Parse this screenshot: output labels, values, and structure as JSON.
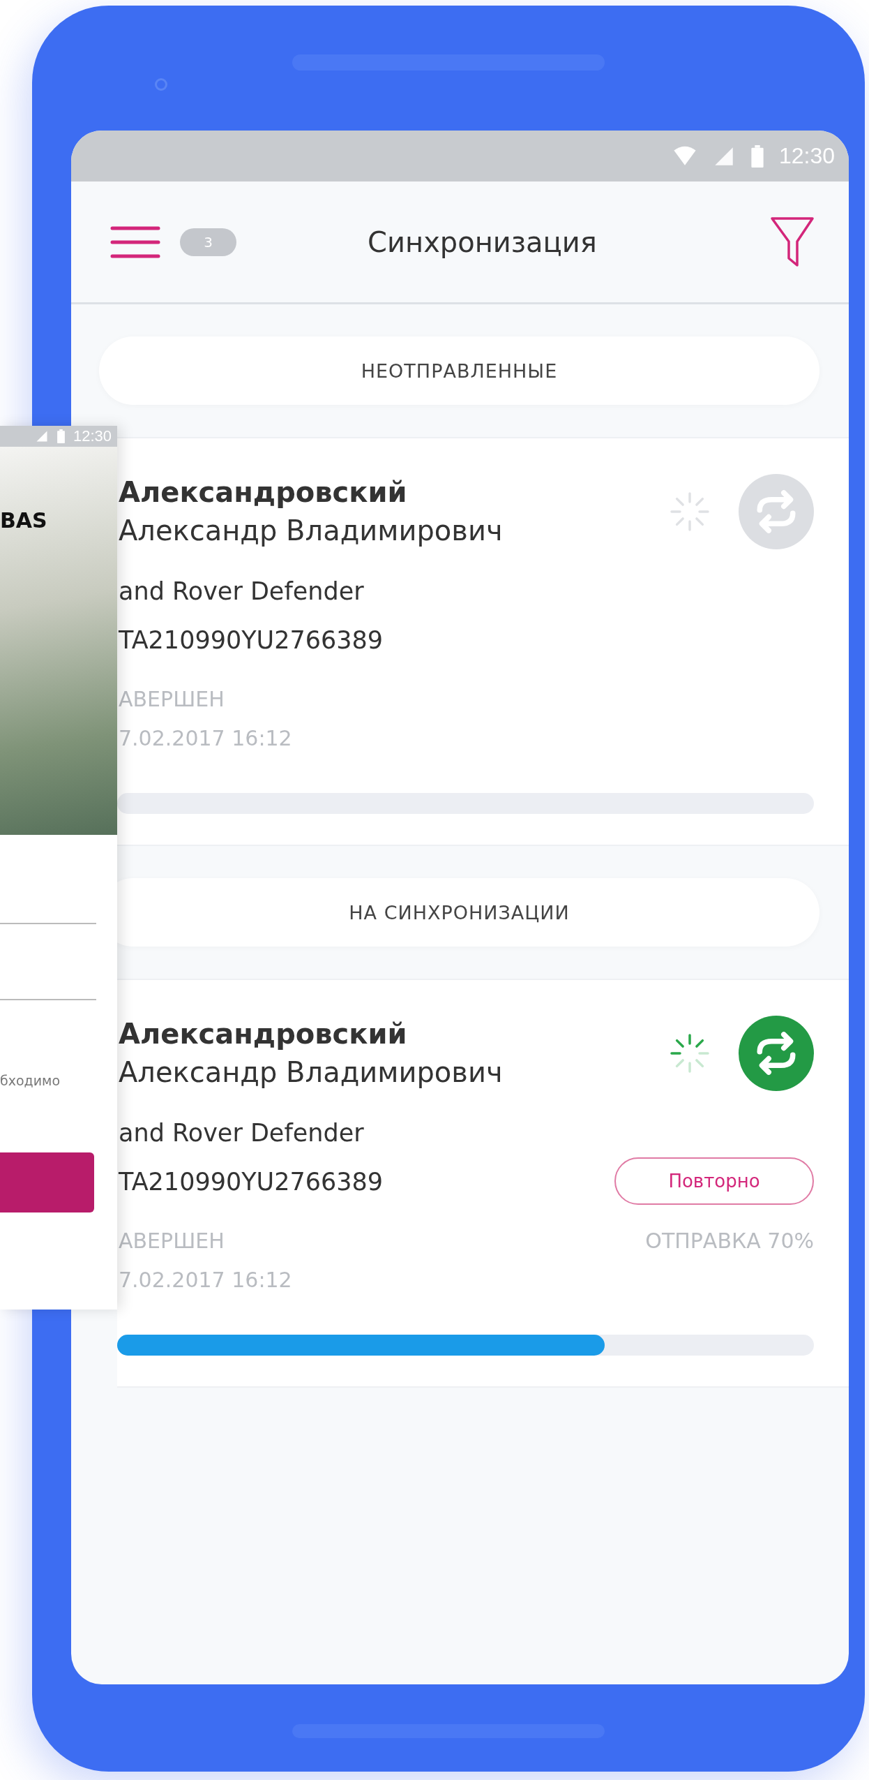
{
  "status_bar": {
    "time": "12:30"
  },
  "header": {
    "badge": "3",
    "title": "Синхронизация"
  },
  "sections": [
    {
      "title": "НЕОТПРАВЛЕННЫЕ",
      "items": [
        {
          "surname": "Александровский",
          "name": "Александр Владимирович",
          "car": "and Rover Defender",
          "vin": "TA210990YU2766389",
          "status": "АВЕРШЕН",
          "date": "7.02.2017 16:12",
          "syncing": false
        }
      ]
    },
    {
      "title": "НА СИНХРОНИЗАЦИИ",
      "items": [
        {
          "surname": "Александровский",
          "name": "Александр Владимирович",
          "car": "and Rover Defender",
          "vin": "TA210990YU2766389",
          "status": "АВЕРШЕН",
          "date": "7.02.2017 16:12",
          "syncing": true,
          "retry_label": "Повторно",
          "progress_text": "ОТПРАВКА 70%",
          "level": 0.7
        }
      ]
    }
  ],
  "back_screen": {
    "time": "12:30",
    "banner_text": "BAS",
    "hint": "бходимо"
  }
}
